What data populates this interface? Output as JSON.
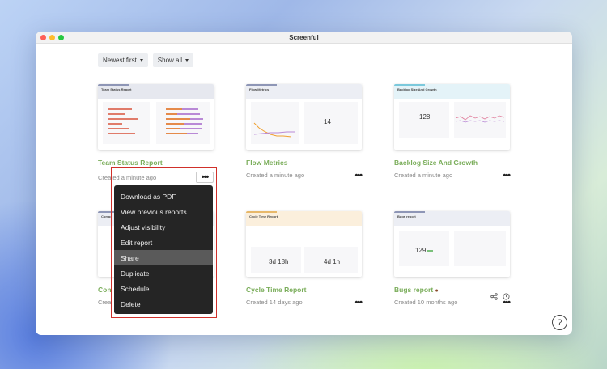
{
  "window": {
    "title": "Screenful"
  },
  "toolbar": {
    "sort_label": "Newest first",
    "filter_label": "Show all"
  },
  "reports": [
    {
      "title": "Team Status Report",
      "meta": "Created a minute ago",
      "thumb_title": "Team Status Report",
      "accent": "#8e96b6"
    },
    {
      "title": "Flow Metrics",
      "meta": "Created a minute ago",
      "thumb_title": "Flow Metrics",
      "accent": "#8e96b6"
    },
    {
      "title": "Backlog Size And Growth",
      "meta": "Created a minute ago",
      "thumb_title": "Backlog Size And Growth",
      "accent": "#7bc9dc"
    },
    {
      "title": "Con",
      "meta": "Crea",
      "thumb_title": "Compo",
      "accent": "#8e96b6"
    },
    {
      "title": "Cycle Time Report",
      "meta": "Created 14 days ago",
      "thumb_title": "Cycle Time Report",
      "accent": "#e7b86a"
    },
    {
      "title": "Bugs report",
      "meta": "Created 10 months ago",
      "thumb_title": "Bugs report",
      "accent": "#8e96b6"
    }
  ],
  "thumb_values": {
    "flow_wip": "14",
    "backlog_count": "128",
    "cycle_a": "3d 18h",
    "cycle_b": "4d 1h",
    "bugs_count": "129"
  },
  "menu": {
    "items": [
      "Download as PDF",
      "View previous reports",
      "Adjust visibility",
      "Edit report",
      "Share",
      "Duplicate",
      "Schedule",
      "Delete"
    ],
    "active_index": 4
  },
  "help": {
    "label": "?"
  },
  "colors": {
    "title_green": "#7aad5a",
    "menu_bg": "#252525",
    "highlight_outline": "#d0302a"
  },
  "icons": [
    "share-icon",
    "clock-icon",
    "more-icon",
    "help-icon",
    "caret-down-icon"
  ]
}
